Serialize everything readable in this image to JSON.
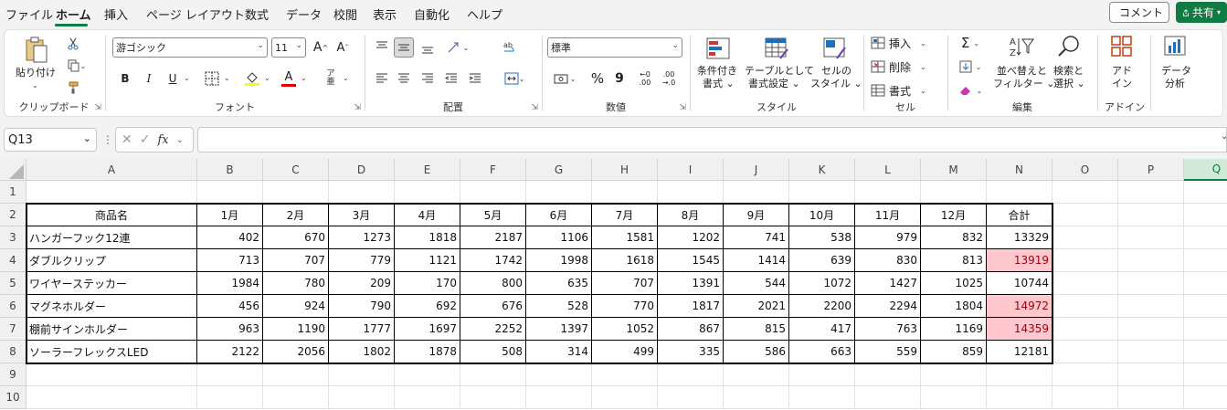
{
  "menu": {
    "items": [
      "ファイル",
      "ホーム",
      "挿入",
      "ページ レイアウト",
      "数式",
      "データ",
      "校閲",
      "表示",
      "自動化",
      "ヘルプ"
    ],
    "active": "ホーム",
    "comment_label": "コメント",
    "share_label": "共有",
    "accent": "#107c41"
  },
  "ribbon": {
    "clipboard": {
      "paste_label": "貼り付け",
      "group_label": "クリップボード"
    },
    "font": {
      "font_name": "游ゴシック",
      "font_size": "11",
      "group_label": "フォント",
      "bold": "B",
      "italic": "I",
      "underline": "U"
    },
    "alignment": {
      "group_label": "配置"
    },
    "number": {
      "format": "標準",
      "group_label": "数値",
      "percent": "%",
      "comma": "9"
    },
    "styles": {
      "conditional": [
        "条件付き",
        "書式 ⌄"
      ],
      "as_table": [
        "テーブルとして",
        "書式設定 ⌄"
      ],
      "cell_styles": [
        "セルの",
        "スタイル ⌄"
      ],
      "group_label": "スタイル"
    },
    "cells": {
      "insert": "挿入",
      "delete": "削除",
      "format": "書式",
      "group_label": "セル"
    },
    "editing": {
      "sort_filter": [
        "並べ替えと",
        "フィルター ⌄"
      ],
      "find_select": [
        "検索と",
        "選択 ⌄"
      ],
      "group_label": "編集"
    },
    "addins": {
      "addin": [
        "アド",
        "イン"
      ],
      "group_label": "アドイン"
    },
    "analysis": {
      "analyze": [
        "データ",
        "分析"
      ]
    }
  },
  "formula_bar": {
    "name_box": "Q13",
    "fx": "fx",
    "formula": ""
  },
  "grid": {
    "columns": [
      "A",
      "B",
      "C",
      "D",
      "E",
      "F",
      "G",
      "H",
      "I",
      "J",
      "K",
      "L",
      "M",
      "N",
      "O",
      "P",
      "Q"
    ],
    "rows": [
      "1",
      "2",
      "3",
      "4",
      "5",
      "6",
      "7",
      "8",
      "9",
      "10"
    ],
    "selected_column": "Q",
    "highlight_fill": "#ffc7ce",
    "highlight_text": "#9c0006",
    "table": {
      "header": [
        "商品名",
        "1月",
        "2月",
        "3月",
        "4月",
        "5月",
        "6月",
        "7月",
        "8月",
        "9月",
        "10月",
        "11月",
        "12月",
        "合計"
      ],
      "rows": [
        {
          "name": "ハンガーフック12連",
          "values": [
            "402",
            "670",
            "1273",
            "1818",
            "2187",
            "1106",
            "1581",
            "1202",
            "741",
            "538",
            "979",
            "832"
          ],
          "total": "13329",
          "highlight": false
        },
        {
          "name": "ダブルクリップ",
          "values": [
            "713",
            "707",
            "779",
            "1121",
            "1742",
            "1998",
            "1618",
            "1545",
            "1414",
            "639",
            "830",
            "813"
          ],
          "total": "13919",
          "highlight": true
        },
        {
          "name": "ワイヤーステッカー",
          "values": [
            "1984",
            "780",
            "209",
            "170",
            "800",
            "635",
            "707",
            "1391",
            "544",
            "1072",
            "1427",
            "1025"
          ],
          "total": "10744",
          "highlight": false
        },
        {
          "name": "マグネホルダー",
          "values": [
            "456",
            "924",
            "790",
            "692",
            "676",
            "528",
            "770",
            "1817",
            "2021",
            "2200",
            "2294",
            "1804"
          ],
          "total": "14972",
          "highlight": true
        },
        {
          "name": "棚前サインホルダー",
          "values": [
            "963",
            "1190",
            "1777",
            "1697",
            "2252",
            "1397",
            "1052",
            "867",
            "815",
            "417",
            "763",
            "1169"
          ],
          "total": "14359",
          "highlight": true
        },
        {
          "name": "ソーラーフレックスLED",
          "values": [
            "2122",
            "2056",
            "1802",
            "1878",
            "508",
            "314",
            "499",
            "335",
            "586",
            "663",
            "559",
            "859"
          ],
          "total": "12181",
          "highlight": false
        }
      ]
    }
  }
}
